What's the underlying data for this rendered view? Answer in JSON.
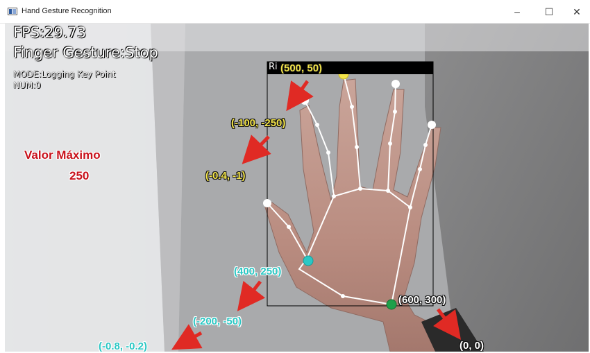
{
  "window": {
    "title": "Hand Gesture Recognition",
    "controls": {
      "minimize": "–",
      "maximize": "☐",
      "close": "✕"
    }
  },
  "overlay": {
    "fps": "FPS:29.73",
    "gesture": "Finger Gesture:Stop",
    "mode": "MODE:Logging Key Point",
    "num": "NUM:0",
    "hand_label": "Ri"
  },
  "annotation": {
    "max_title": "Valor Máximo",
    "max_value": "250",
    "yellow": [
      "(500, 50)",
      "(-100, -250)",
      "(-0.4, -1)"
    ],
    "cyan": [
      "(400, 250)",
      "(-200, -50)",
      "(-0.8, -0.2)"
    ],
    "green": [
      "(600, 300)",
      "(0, 0)"
    ]
  },
  "colors": {
    "yellow": "#f2e34a",
    "cyan": "#2bc7c4",
    "green": "#1fa04a",
    "arrow": "#e02a24",
    "max_red": "#c8101a"
  },
  "icons": {
    "app": "window-app-icon"
  }
}
